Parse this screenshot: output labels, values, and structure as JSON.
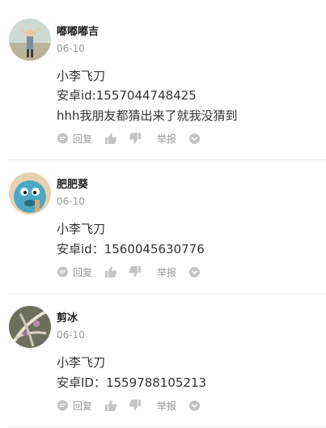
{
  "comments": [
    {
      "username": "嘟嘟嘟吉",
      "date": "06-10",
      "lines": [
        "小李飞刀",
        "安卓id:1557044748425",
        "hhh我朋友都猜出来了就我没猜到"
      ],
      "actions": {
        "reply_label": "回复",
        "report_label": "举报"
      }
    },
    {
      "username": "肥肥葵",
      "date": "06-10",
      "lines": [
        "小李飞刀",
        "安卓id：1560045630776"
      ],
      "actions": {
        "reply_label": "回复",
        "report_label": "举报"
      }
    },
    {
      "username": "剪冰",
      "date": "06-10",
      "lines": [
        "小李飞刀",
        "安卓ID：1559788105213"
      ],
      "actions": {
        "reply_label": "回复",
        "report_label": "举报"
      }
    }
  ],
  "colors": {
    "text": "#333333",
    "muted": "#999999",
    "icon": "#c4c4c4",
    "divider": "#eeeeee"
  }
}
